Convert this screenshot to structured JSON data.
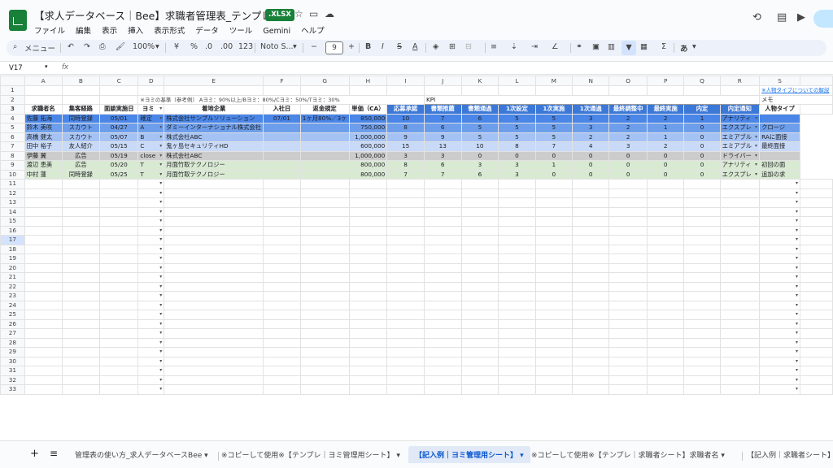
{
  "app": {
    "title": "【求人データベース｜Bee】求職者管理表_テンプレート",
    "badge": ".XLSX",
    "menu": [
      "ファイル",
      "編集",
      "表示",
      "挿入",
      "表示形式",
      "データ",
      "ツール",
      "Gemini",
      "ヘルプ"
    ]
  },
  "toolbar": {
    "search_label": "メニュー",
    "zoom": "100%",
    "currency": "¥",
    "percent": "%",
    "dec_down": ".0",
    "dec_up": ".00",
    "number_format": "123",
    "font": "Noto S...",
    "font_size": "9",
    "bold": "B",
    "italic": "I",
    "strike": "S",
    "text_color": "A",
    "sigma": "Σ",
    "input_mode": "あ"
  },
  "formula_bar": {
    "name_box": "V17",
    "fx": "fx"
  },
  "grid": {
    "columns": [
      "A",
      "B",
      "C",
      "D",
      "E",
      "F",
      "G",
      "H",
      "I",
      "J",
      "K",
      "L",
      "M",
      "N",
      "O",
      "P",
      "Q",
      "R",
      "S"
    ],
    "row2_note": "※ヨミの基準（参考例） Aヨミ：90%以上/Bヨミ：80%/Cヨミ：50%/Tヨミ：30%",
    "row1_link": "※人物タイプについての解説",
    "kpi_label": "KPI",
    "memo_label": "メモ",
    "headers": [
      "求職者名",
      "集客経路",
      "面談実施日",
      "ヨミ",
      "着地企業",
      "入社日",
      "返金規定",
      "単価（CA）",
      "応募承諾",
      "書類推薦",
      "書類通過",
      "1次設定",
      "1次実施",
      "1次通過",
      "最終調整中",
      "最終実施",
      "内定",
      "内定通知",
      "人物タイプ"
    ],
    "rows": [
      {
        "name": "佐藤 拓海",
        "route": "同時登録",
        "date": "05/01",
        "yomi": "確定",
        "company": "株式会社サンプルソリューション",
        "join": "07/01",
        "refund": "1ヶ月80%／3ヶ",
        "price": "850,000",
        "kpi": [
          "10",
          "7",
          "6",
          "5",
          "5",
          "3",
          "2",
          "2",
          "1"
        ],
        "type": "アナリティ",
        "memo": "",
        "color": "#4a86e8"
      },
      {
        "name": "鈴木 美咲",
        "route": "スカウト",
        "date": "04/27",
        "yomi": "A",
        "company": "ダミーインターナショナル株式会社",
        "join": "",
        "refund": "",
        "price": "750,000",
        "kpi": [
          "8",
          "6",
          "5",
          "5",
          "5",
          "3",
          "2",
          "1",
          "0"
        ],
        "type": "エクスプレ",
        "memo": "クロージ",
        "color": "#6d9eeb"
      },
      {
        "name": "高橋 健太",
        "route": "スカウト",
        "date": "05/07",
        "yomi": "B",
        "company": "株式会社ABC",
        "join": "",
        "refund": "",
        "price": "1,000,000",
        "kpi": [
          "9",
          "9",
          "5",
          "5",
          "5",
          "2",
          "2",
          "1",
          "0"
        ],
        "type": "エミアブル",
        "memo": "RAに面接",
        "color": "#a4c2f4"
      },
      {
        "name": "田中 裕子",
        "route": "友人紹介",
        "date": "05/15",
        "yomi": "C",
        "company": "鬼ヶ島セキュリティHD",
        "join": "",
        "refund": "",
        "price": "600,000",
        "kpi": [
          "15",
          "13",
          "10",
          "8",
          "7",
          "4",
          "3",
          "2",
          "0"
        ],
        "type": "エミアブル",
        "memo": "最終面接",
        "color": "#c9daf8"
      },
      {
        "name": "伊藤 翼",
        "route": "広告",
        "date": "05/19",
        "yomi": "close",
        "company": "株式会社ABC",
        "join": "",
        "refund": "",
        "price": "1,000,000",
        "kpi": [
          "3",
          "3",
          "0",
          "0",
          "0",
          "0",
          "0",
          "0",
          "0"
        ],
        "type": "ドライバー",
        "memo": "",
        "color": "#cccccc"
      },
      {
        "name": "渡辺 恵美",
        "route": "広告",
        "date": "05/20",
        "yomi": "T",
        "company": "月面竹取テクノロジー",
        "join": "",
        "refund": "",
        "price": "800,000",
        "kpi": [
          "8",
          "6",
          "3",
          "3",
          "1",
          "0",
          "0",
          "0",
          "0"
        ],
        "type": "アナリティ",
        "memo": "初回の面",
        "color": "#d9ead3"
      },
      {
        "name": "中村 蓮",
        "route": "同時登録",
        "date": "05/25",
        "yomi": "T",
        "company": "月面竹取テクノロジー",
        "join": "",
        "refund": "",
        "price": "800,000",
        "kpi": [
          "7",
          "7",
          "6",
          "3",
          "0",
          "0",
          "0",
          "0",
          "0"
        ],
        "type": "エクスプレ",
        "memo": "追加の求",
        "color": "#d9ead3"
      }
    ],
    "empty_row_start": 11,
    "empty_row_end": 33
  },
  "tabs": [
    {
      "label": "管理表の使い方_求人データベースBee",
      "active": false
    },
    {
      "label": "※コピーして使用※【テンプレ｜ヨミ管理用シート】",
      "active": false
    },
    {
      "label": "【記入例｜ヨミ管理用シート】",
      "active": true
    },
    {
      "label": "※コピーして使用※【テンプレ｜求職者シート】求職者名",
      "active": false
    },
    {
      "label": "【記入例｜求職者シート】",
      "active": false
    }
  ],
  "colors": {
    "accent": "#0b57d0",
    "kpi_header": "#3c78d8",
    "xlsx_badge": "#188038"
  }
}
